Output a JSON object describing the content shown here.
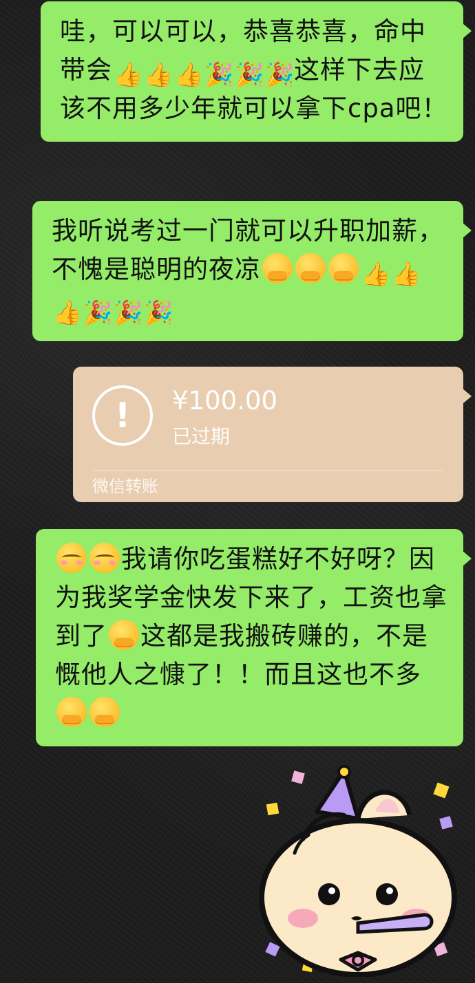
{
  "messages": [
    {
      "id": "msg1",
      "segments": [
        {
          "t": "text",
          "v": "哇，可以可以，恭喜恭喜，命中带会"
        },
        {
          "t": "emoji",
          "k": "thumbs-up-icon",
          "v": "👍"
        },
        {
          "t": "emoji",
          "k": "thumbs-up-icon",
          "v": "👍"
        },
        {
          "t": "emoji",
          "k": "thumbs-up-icon",
          "v": "👍"
        },
        {
          "t": "emoji",
          "k": "party-popper-icon",
          "v": "🎉"
        },
        {
          "t": "emoji",
          "k": "party-popper-icon",
          "v": "🎉"
        },
        {
          "t": "emoji",
          "k": "party-popper-icon",
          "v": "🎉"
        },
        {
          "t": "text",
          "v": "这样下去应该不用多少年就可以拿下cpa吧！"
        }
      ]
    },
    {
      "id": "msg2",
      "segments": [
        {
          "t": "text",
          "v": "我听说考过一门就可以升职加薪，不愧是聪明的夜凉"
        },
        {
          "t": "emoji",
          "k": "hugging-face-icon",
          "v": ""
        },
        {
          "t": "emoji",
          "k": "hugging-face-icon",
          "v": ""
        },
        {
          "t": "emoji",
          "k": "hugging-face-icon",
          "v": ""
        },
        {
          "t": "emoji",
          "k": "thumbs-up-icon",
          "v": "👍"
        },
        {
          "t": "emoji",
          "k": "thumbs-up-icon",
          "v": "👍"
        },
        {
          "t": "emoji",
          "k": "thumbs-up-icon",
          "v": "👍"
        },
        {
          "t": "emoji",
          "k": "party-popper-icon",
          "v": "🎉"
        },
        {
          "t": "emoji",
          "k": "party-popper-icon",
          "v": "🎉"
        },
        {
          "t": "emoji",
          "k": "party-popper-icon",
          "v": "🎉"
        }
      ]
    },
    {
      "id": "msg4",
      "segments": [
        {
          "t": "emoji",
          "k": "relieved-face-icon",
          "v": ""
        },
        {
          "t": "emoji",
          "k": "relieved-face-icon",
          "v": ""
        },
        {
          "t": "text",
          "v": "我请你吃蛋糕好不好呀？因为我奖学金快发下来了，工资也拿到了"
        },
        {
          "t": "emoji",
          "k": "hugging-face-icon",
          "v": ""
        },
        {
          "t": "text",
          "v": "这都是我搬砖赚的，不是慨他人之慷了！！而且这也不多"
        },
        {
          "t": "emoji",
          "k": "hugging-face-icon",
          "v": ""
        },
        {
          "t": "emoji",
          "k": "hugging-face-icon",
          "v": ""
        }
      ]
    }
  ],
  "transfer": {
    "amount": "¥100.00",
    "status": "已过期",
    "footer": "微信转账",
    "icon": "exclamation-circle-icon",
    "color": "#e9cdb0"
  },
  "sticker": {
    "icon": "party-bun-sticker-icon"
  },
  "colors": {
    "bubble": "#95ec69",
    "background": "#1e1e1e"
  }
}
